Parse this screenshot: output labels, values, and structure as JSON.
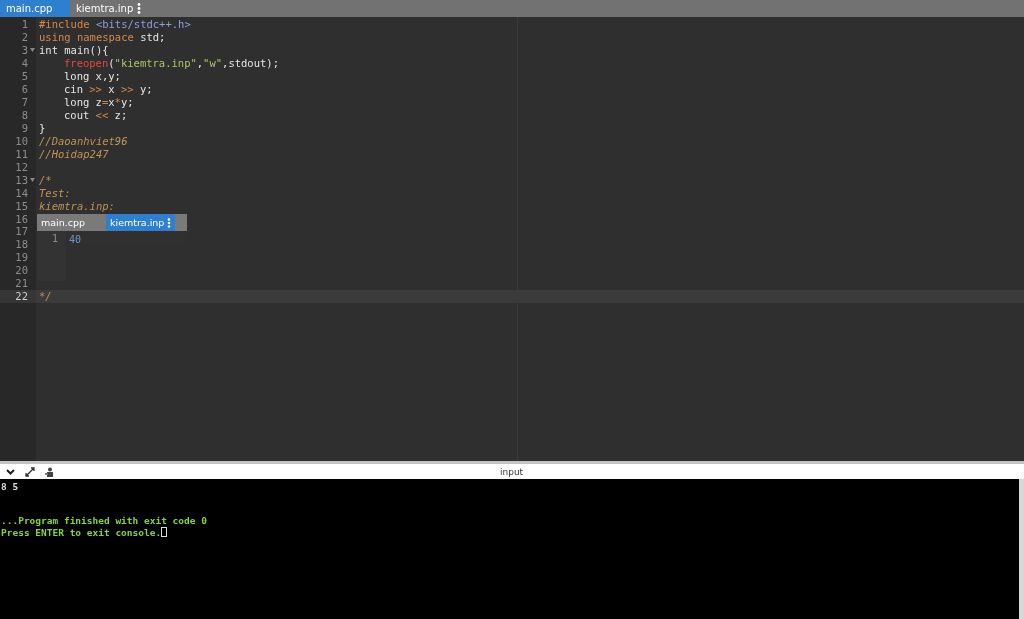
{
  "tabs": [
    {
      "label": "main.cpp",
      "selected": true
    },
    {
      "label": "kiemtra.inp",
      "selected": false
    }
  ],
  "editor": {
    "lines": [
      {
        "number": "1",
        "foldable": false,
        "active": false,
        "tokens": [
          {
            "kind": "preproc",
            "text": "#include "
          },
          {
            "kind": "include",
            "text": "<bits/stdc++.h>"
          }
        ]
      },
      {
        "number": "2",
        "foldable": false,
        "active": false,
        "tokens": [
          {
            "kind": "keyword",
            "text": "using namespace"
          },
          {
            "kind": "plain",
            "text": " std;"
          }
        ]
      },
      {
        "number": "3",
        "foldable": true,
        "active": false,
        "tokens": [
          {
            "kind": "plain",
            "text": "int main(){"
          }
        ]
      },
      {
        "number": "4",
        "foldable": false,
        "active": false,
        "indented": true,
        "tokens": [
          {
            "kind": "function",
            "text": "freopen"
          },
          {
            "kind": "plain",
            "text": "("
          },
          {
            "kind": "string",
            "text": "\"kiemtra.inp\""
          },
          {
            "kind": "plain",
            "text": ","
          },
          {
            "kind": "string",
            "text": "\"w\""
          },
          {
            "kind": "plain",
            "text": ",stdout);"
          }
        ]
      },
      {
        "number": "5",
        "foldable": false,
        "active": false,
        "indented": true,
        "tokens": [
          {
            "kind": "plain",
            "text": "long x,y;"
          }
        ]
      },
      {
        "number": "6",
        "foldable": false,
        "active": false,
        "indented": true,
        "tokens": [
          {
            "kind": "plain",
            "text": "cin "
          },
          {
            "kind": "operator",
            "text": ">>"
          },
          {
            "kind": "plain",
            "text": " x "
          },
          {
            "kind": "operator",
            "text": ">>"
          },
          {
            "kind": "plain",
            "text": " y;"
          }
        ]
      },
      {
        "number": "7",
        "foldable": false,
        "active": false,
        "indented": true,
        "tokens": [
          {
            "kind": "plain",
            "text": "long z"
          },
          {
            "kind": "operator",
            "text": "="
          },
          {
            "kind": "plain",
            "text": "x"
          },
          {
            "kind": "operator",
            "text": "*"
          },
          {
            "kind": "plain",
            "text": "y;"
          }
        ]
      },
      {
        "number": "8",
        "foldable": false,
        "active": false,
        "indented": true,
        "tokens": [
          {
            "kind": "plain",
            "text": "cout "
          },
          {
            "kind": "operator",
            "text": "<<"
          },
          {
            "kind": "plain",
            "text": " z;"
          }
        ]
      },
      {
        "number": "9",
        "foldable": false,
        "active": false,
        "tokens": [
          {
            "kind": "plain",
            "text": "}"
          }
        ]
      },
      {
        "number": "10",
        "foldable": false,
        "active": false,
        "tokens": [
          {
            "kind": "comment",
            "text": "//Daoanhviet96"
          }
        ]
      },
      {
        "number": "11",
        "foldable": false,
        "active": false,
        "tokens": [
          {
            "kind": "comment",
            "text": "//Hoidap247"
          }
        ]
      },
      {
        "number": "12",
        "foldable": false,
        "active": false
      },
      {
        "number": "13",
        "foldable": true,
        "active": false,
        "tokens": [
          {
            "kind": "comment",
            "text": "/*"
          }
        ]
      },
      {
        "number": "14",
        "foldable": false,
        "active": false,
        "tokens": [
          {
            "kind": "comment",
            "text": "Test:"
          }
        ]
      },
      {
        "number": "15",
        "foldable": false,
        "active": false,
        "tokens": [
          {
            "kind": "comment",
            "text": "kiemtra.inp:"
          }
        ]
      },
      {
        "number": "16",
        "foldable": false,
        "active": false
      },
      {
        "number": "17",
        "foldable": false,
        "active": false
      },
      {
        "number": "18",
        "foldable": false,
        "active": false
      },
      {
        "number": "19",
        "foldable": false,
        "active": false
      },
      {
        "number": "20",
        "foldable": false,
        "active": false
      },
      {
        "number": "21",
        "foldable": false,
        "active": false
      },
      {
        "number": "22",
        "foldable": false,
        "active": true,
        "tokens": [
          {
            "kind": "comment",
            "text": "*/"
          }
        ]
      }
    ]
  },
  "embedded_editor": {
    "tabs": [
      {
        "label": "main.cpp",
        "selected": false
      },
      {
        "label": "kiemtra.inp",
        "selected": true
      }
    ],
    "lines": [
      {
        "number": "1",
        "text": "40"
      }
    ]
  },
  "console": {
    "title": "input",
    "input_echo": "8 5",
    "messages": [
      "...Program finished with exit code 0",
      "Press ENTER to exit console."
    ],
    "cursor_visible": true
  }
}
